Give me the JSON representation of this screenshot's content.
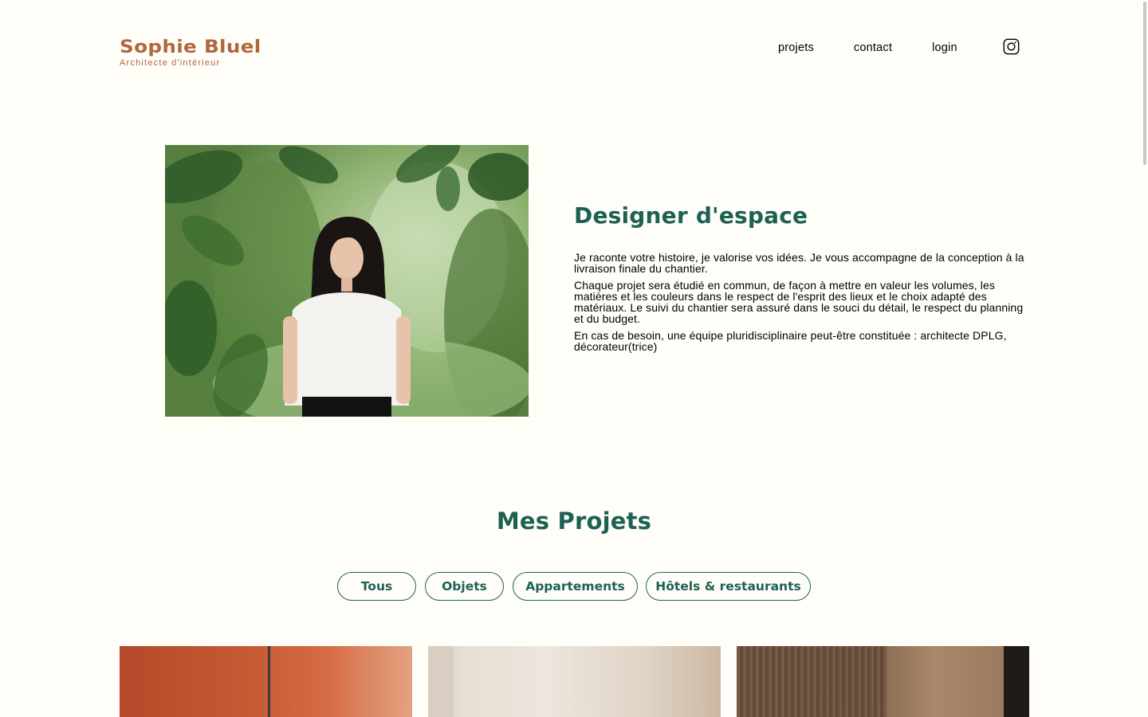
{
  "header": {
    "logo_name": "Sophie Bluel",
    "logo_subtitle": "Architecte d'intérieur",
    "nav": [
      "projets",
      "contact",
      "login"
    ],
    "social_icon": "instagram-icon"
  },
  "intro": {
    "title": "Designer d'espace",
    "paragraphs": [
      "Je raconte votre histoire, je valorise vos idées. Je vous accompagne de la conception à la livraison finale du chantier.",
      "Chaque projet sera étudié en commun, de façon à mettre en valeur les volumes, les matières et les couleurs dans le respect de l'esprit des lieux et le choix adapté des matériaux. Le suivi du chantier sera assuré dans le souci du détail, le respect du planning et du budget.",
      "En cas de besoin, une équipe pluridisciplinaire peut-être constituée : architecte DPLG, décorateur(trice)"
    ]
  },
  "projects": {
    "title": "Mes Projets",
    "filters": [
      "Tous",
      "Objets",
      "Appartements",
      "Hôtels & restaurants"
    ]
  },
  "colors": {
    "brand": "#B1663C",
    "accent": "#1D6154",
    "background": "#FFFEF8"
  }
}
